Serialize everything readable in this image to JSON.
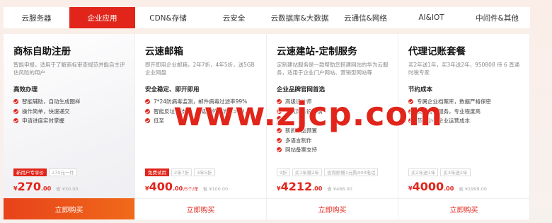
{
  "tabs": [
    {
      "label": "云服务器",
      "active": false
    },
    {
      "label": "企业应用",
      "active": true
    },
    {
      "label": "CDN&存储",
      "active": false
    },
    {
      "label": "云安全",
      "active": false
    },
    {
      "label": "云数据库&大数据",
      "active": false
    },
    {
      "label": "云通信&网络",
      "active": false
    },
    {
      "label": "AI&IOT",
      "active": false
    },
    {
      "label": "中间件&其他",
      "active": false
    }
  ],
  "cards": [
    {
      "title": "商标自助注册",
      "desc": "智能申报，适用于了解商标审查规范并能自主评估风险的用户",
      "feature_head": "高效办理",
      "features": [
        "智能辅助，自动生成图样",
        "操作简单，快速递交",
        "申请进度实时掌握"
      ],
      "tags": [
        {
          "text": "新用户专享价",
          "hot": true
        },
        {
          "text": "270元一件",
          "hot": false
        }
      ],
      "currency": "¥",
      "price": "270",
      "decimal": ".00",
      "unit": "",
      "original": "省 ¥30.00",
      "buy_label": "立即购买",
      "buy_primary": true
    },
    {
      "title": "云速邮箱",
      "desc": "即开即用企业邮箱，2年7折，4年5折，送5GB企业网盘",
      "feature_head": "安全稳定、即开即用",
      "features": [
        "7*24防病毒监测，邮件病毒过滤率99%",
        "智能反垃圾技术，垃圾邮件过滤率>99.9%",
        "低至"
      ],
      "tags": [
        {
          "text": "免费试用",
          "hot": true
        },
        {
          "text": "2年7折",
          "hot": false
        },
        {
          "text": "4年5折",
          "hot": false
        }
      ],
      "currency": "¥",
      "price": "400",
      "decimal": ".00",
      "unit": "/5个/年",
      "original": "省 ¥100.00",
      "buy_label": "立即购买",
      "buy_primary": false
    },
    {
      "title": "云速建站-定制服务",
      "desc": "定制建站服务是一款帮助您搭建网站的华为云服务，适用于企业门户网站、营销型网站等",
      "feature_head": "企业品牌官网首选",
      "features": [
        "高级设计师",
        "首页风格设计稿",
        "",
        "",
        "新闻产品预置",
        "多语言制作",
        "网站备案支持"
      ],
      "tags": [
        {
          "text": "9折",
          "hot": false
        },
        {
          "text": "买1年赠2年",
          "hot": false
        },
        {
          "text": "咨询即赠1元购400电话",
          "hot": false
        }
      ],
      "currency": "¥",
      "price": "4212",
      "decimal": ".00",
      "unit": "",
      "original": "省 ¥468.00",
      "buy_label": "立即购买",
      "buy_primary": false
    },
    {
      "title": "代理记账套餐",
      "desc": "买2年送1年，买3年送2年，950808 待 6 直通时税专家",
      "feature_head": "节约成本",
      "features": [
        "专属企业档案库，数据严格保密",
        "资深会计服务，专业程度高",
        "节省小微企业运营成本"
      ],
      "tags": [
        {
          "text": "买2年送1年",
          "hot": false
        },
        {
          "text": "买3年送2年",
          "hot": false
        }
      ],
      "currency": "¥",
      "price": "4000",
      "decimal": ".00",
      "unit": "",
      "original": "省 ¥2999.00",
      "buy_label": "立即购买",
      "buy_primary": false
    }
  ],
  "watermark": {
    "text": "www.zjcp.com"
  },
  "colors": {
    "accent": "#e1251b",
    "accent_orange": "#f06a1a"
  }
}
